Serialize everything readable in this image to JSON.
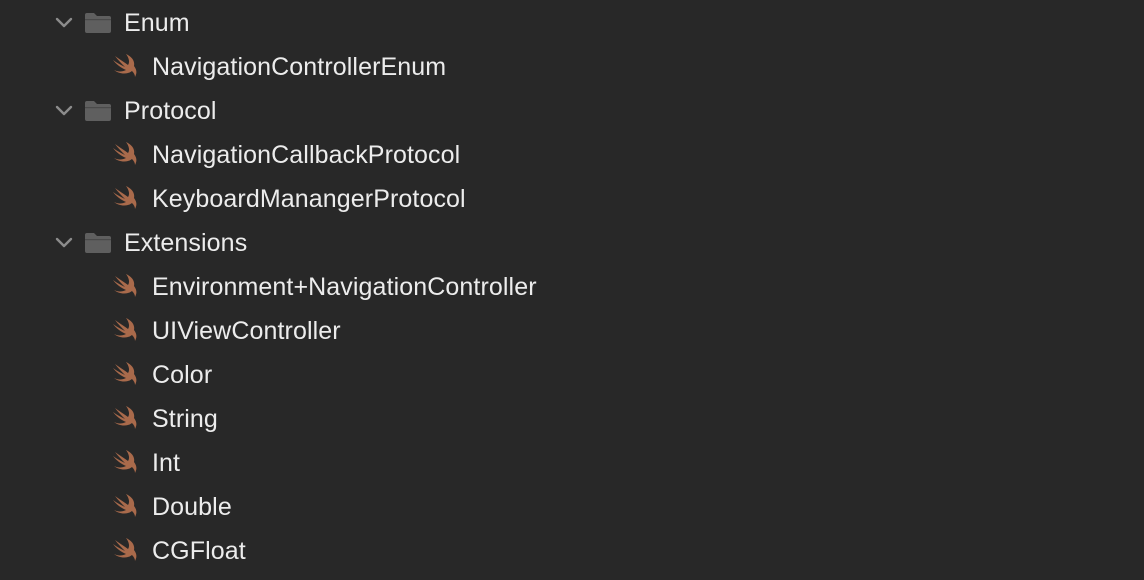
{
  "navigator": {
    "groups": [
      {
        "label": "Enum",
        "icon": "folder-icon",
        "expanded": true,
        "files": [
          {
            "label": "NavigationControllerEnum",
            "icon": "swift-file-icon"
          }
        ]
      },
      {
        "label": "Protocol",
        "icon": "folder-icon",
        "expanded": true,
        "files": [
          {
            "label": "NavigationCallbackProtocol",
            "icon": "swift-file-icon"
          },
          {
            "label": "KeyboardManangerProtocol",
            "icon": "swift-file-icon"
          }
        ]
      },
      {
        "label": "Extensions",
        "icon": "folder-icon",
        "expanded": true,
        "files": [
          {
            "label": "Environment+NavigationController",
            "icon": "swift-file-icon"
          },
          {
            "label": "UIViewController",
            "icon": "swift-file-icon"
          },
          {
            "label": "Color",
            "icon": "swift-file-icon"
          },
          {
            "label": "String",
            "icon": "swift-file-icon"
          },
          {
            "label": "Int",
            "icon": "swift-file-icon"
          },
          {
            "label": "Double",
            "icon": "swift-file-icon"
          },
          {
            "label": "CGFloat",
            "icon": "swift-file-icon"
          }
        ]
      }
    ]
  },
  "colors": {
    "background": "#282828",
    "text": "#ececec",
    "folder": "#5f5f5f",
    "chevron": "#8c8c8c",
    "swift": "#a96a4b"
  }
}
